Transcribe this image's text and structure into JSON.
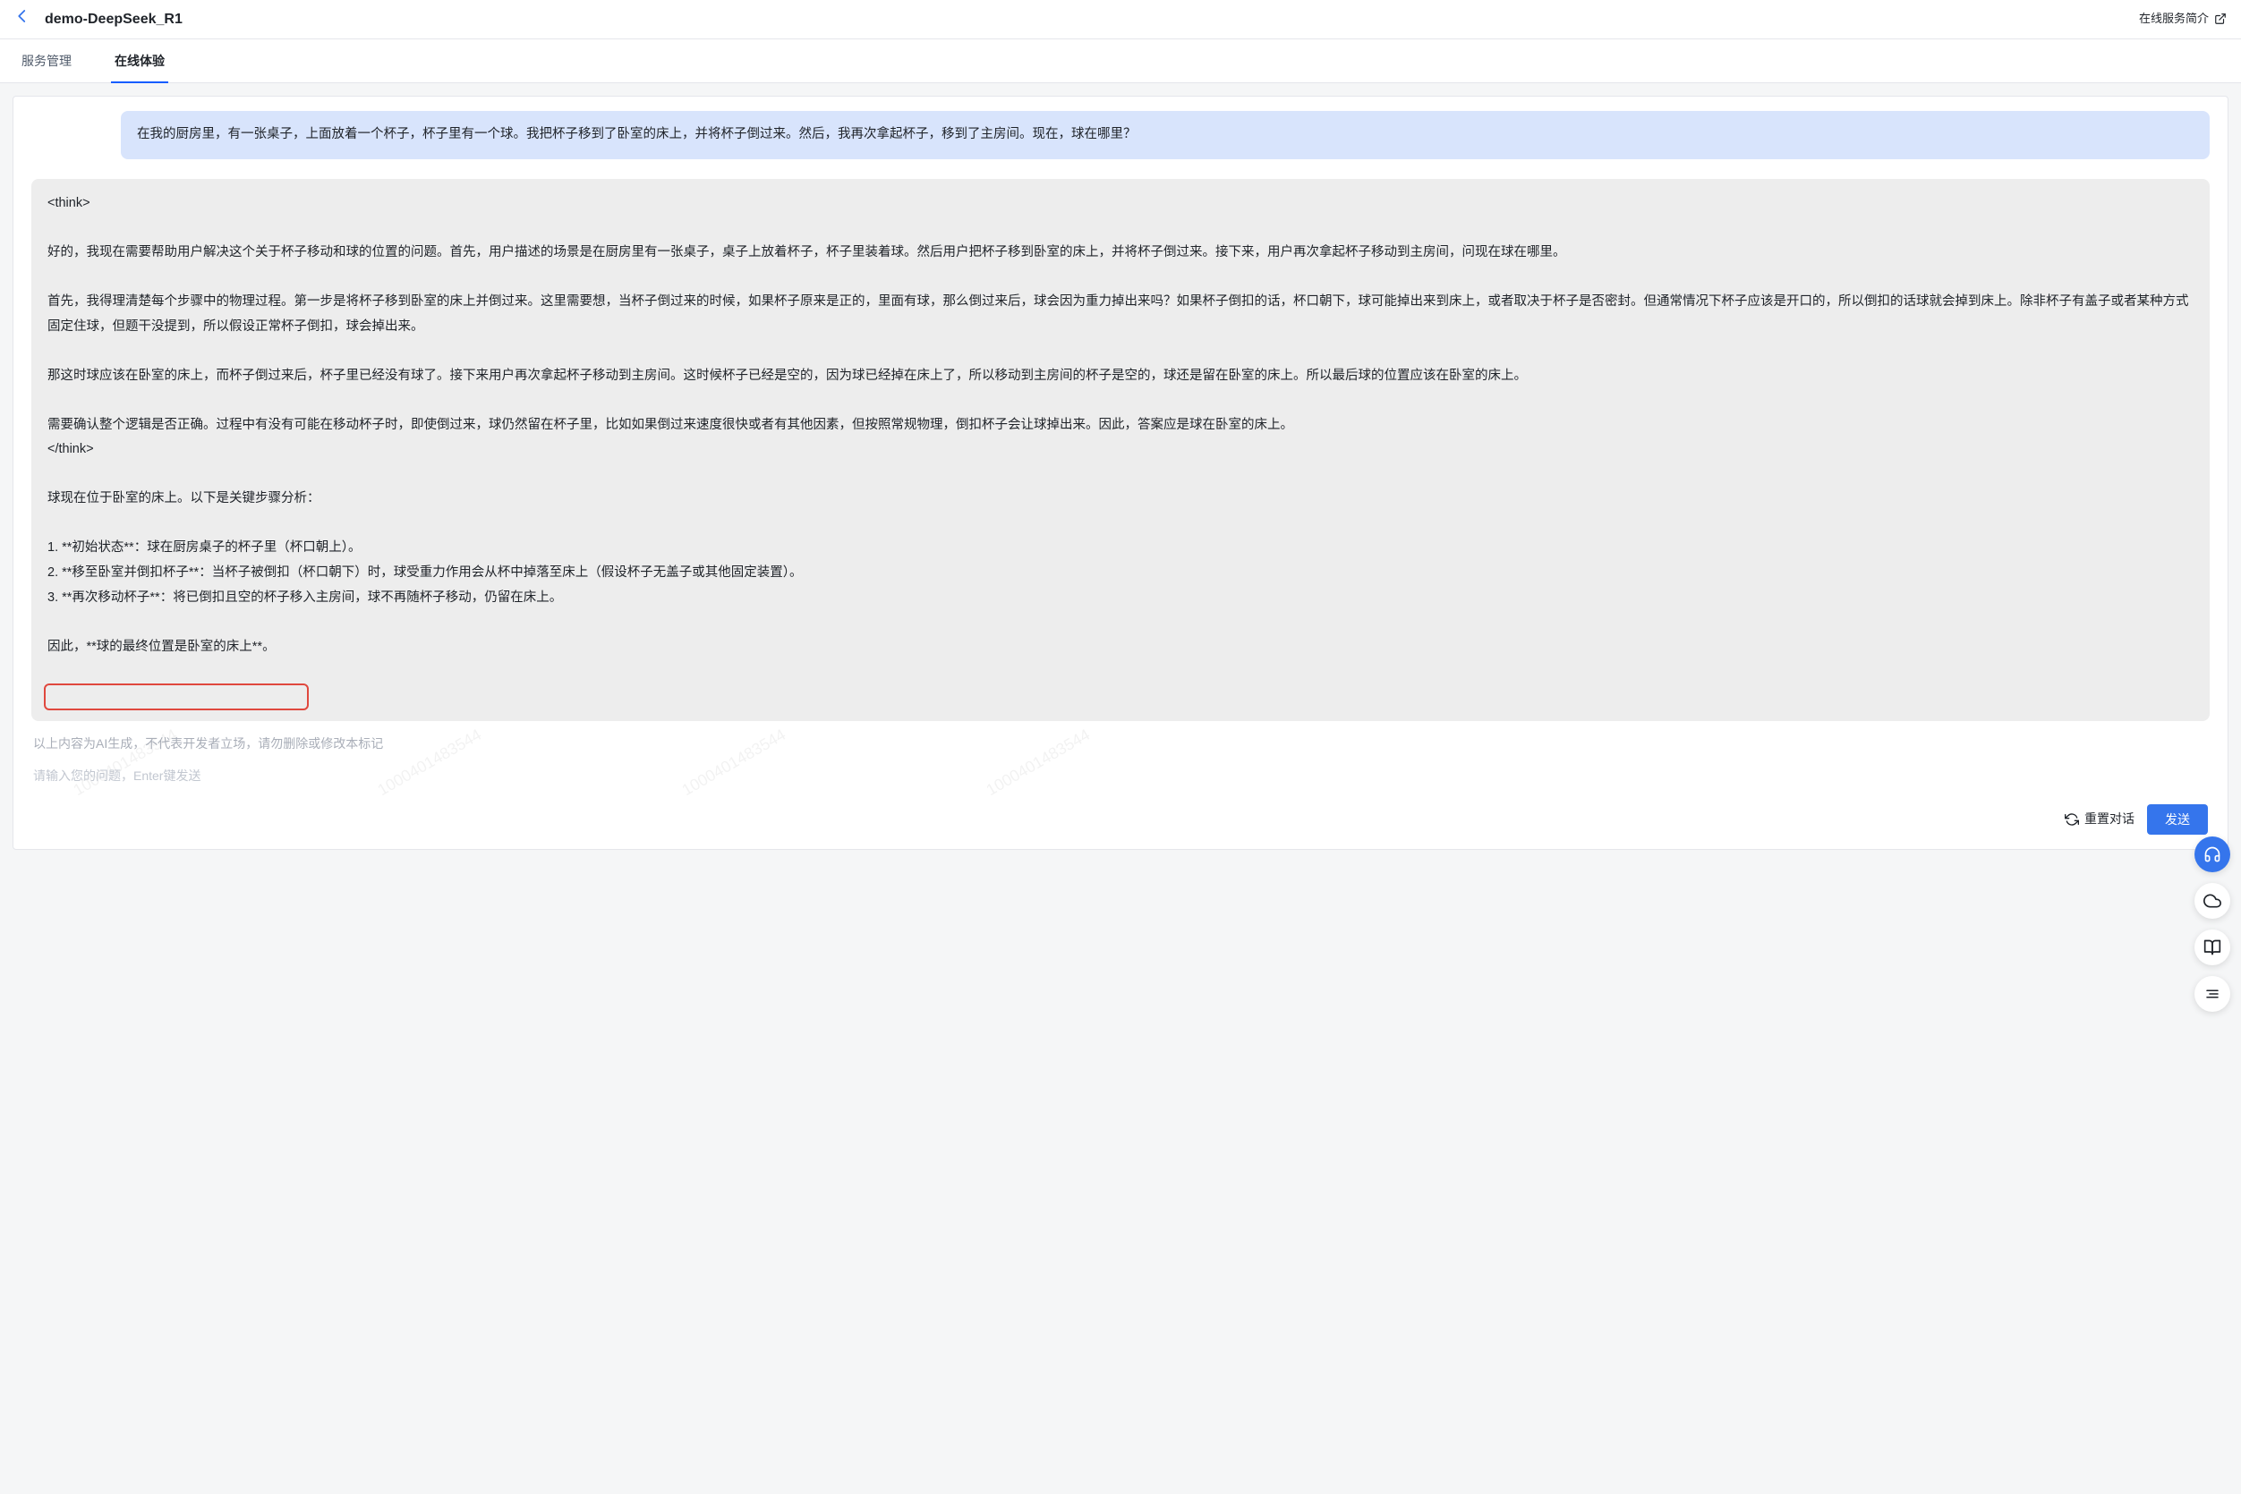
{
  "header": {
    "title": "demo-DeepSeek_R1",
    "service_intro": "在线服务简介"
  },
  "tabs": [
    {
      "label": "服务管理",
      "active": false
    },
    {
      "label": "在线体验",
      "active": true
    }
  ],
  "watermark_text": "1000401483544",
  "conversation": {
    "user_message": "在我的厨房里，有一张桌子，上面放着一个杯子，杯子里有一个球。我把杯子移到了卧室的床上，并将杯子倒过来。然后，我再次拿起杯子，移到了主房间。现在，球在哪里？",
    "assistant_message": "<think>\n\n好的，我现在需要帮助用户解决这个关于杯子移动和球的位置的问题。首先，用户描述的场景是在厨房里有一张桌子，桌子上放着杯子，杯子里装着球。然后用户把杯子移到卧室的床上，并将杯子倒过来。接下来，用户再次拿起杯子移动到主房间，问现在球在哪里。\n\n首先，我得理清楚每个步骤中的物理过程。第一步是将杯子移到卧室的床上并倒过来。这里需要想，当杯子倒过来的时候，如果杯子原来是正的，里面有球，那么倒过来后，球会因为重力掉出来吗？如果杯子倒扣的话，杯口朝下，球可能掉出来到床上，或者取决于杯子是否密封。但通常情况下杯子应该是开口的，所以倒扣的话球就会掉到床上。除非杯子有盖子或者某种方式固定住球，但题干没提到，所以假设正常杯子倒扣，球会掉出来。\n\n那这时球应该在卧室的床上，而杯子倒过来后，杯子里已经没有球了。接下来用户再次拿起杯子移动到主房间。这时候杯子已经是空的，因为球已经掉在床上了，所以移动到主房间的杯子是空的，球还是留在卧室的床上。所以最后球的位置应该在卧室的床上。\n\n需要确认整个逻辑是否正确。过程中有没有可能在移动杯子时，即使倒过来，球仍然留在杯子里，比如如果倒过来速度很快或者有其他因素，但按照常规物理，倒扣杯子会让球掉出来。因此，答案应是球在卧室的床上。\n</think>\n\n球现在位于卧室的床上。以下是关键步骤分析：\n\n1. **初始状态**：球在厨房桌子的杯子里（杯口朝上）。\n2. **移至卧室并倒扣杯子**：当杯子被倒扣（杯口朝下）时，球受重力作用会从杯中掉落至床上（假设杯子无盖子或其他固定装置）。\n3. **再次移动杯子**：将已倒扣且空的杯子移入主房间，球不再随杯子移动，仍留在床上。\n\n因此，**球的最终位置是卧室的床上**。"
  },
  "disclaimer": "以上内容为AI生成，不代表开发者立场，请勿删除或修改本标记",
  "input": {
    "placeholder": "请输入您的问题，Enter键发送"
  },
  "actions": {
    "reset_label": "重置对话",
    "send_label": "发送"
  },
  "float_rail": {
    "headset": "headset-icon",
    "cloud": "cloud-icon",
    "book": "book-icon",
    "list": "list-icon"
  }
}
